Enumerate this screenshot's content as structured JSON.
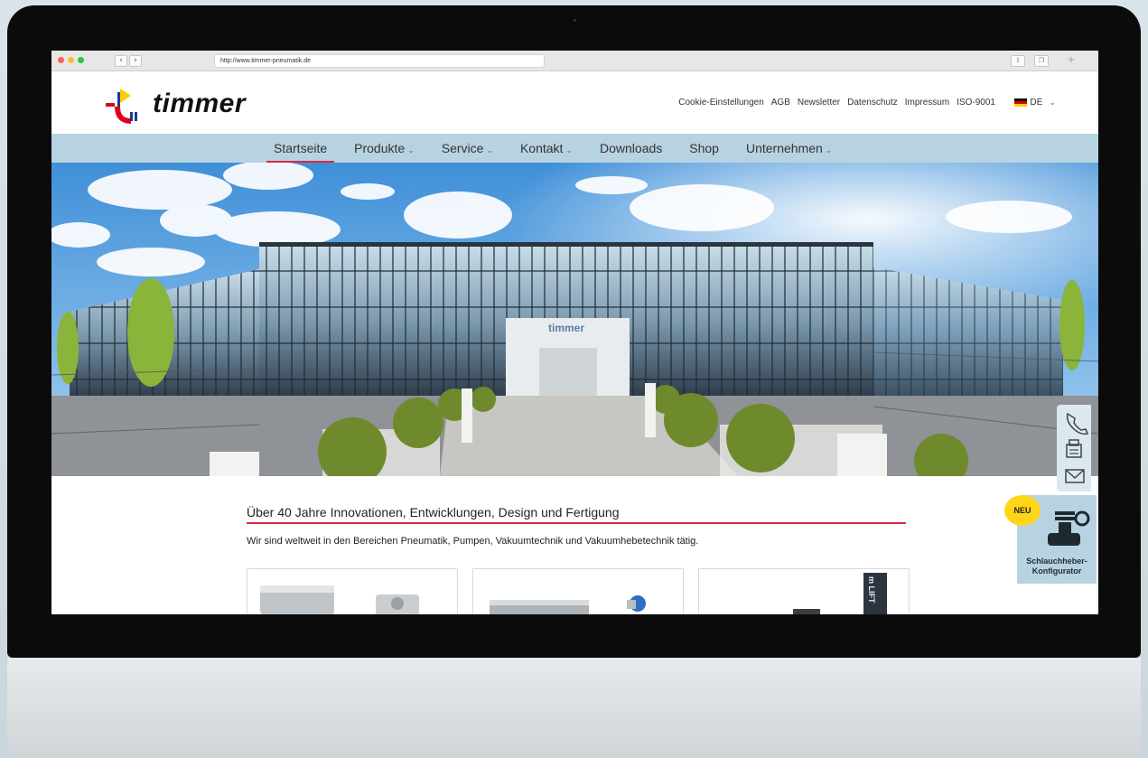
{
  "browser": {
    "url": "http://www.timmer-pneumatik.de",
    "back_label": "‹",
    "forward_label": "›",
    "share_label": "⇧",
    "tabs_label": "❐",
    "newtab_label": "+"
  },
  "header": {
    "brand": "timmer",
    "top_links": [
      "Cookie-Einstellungen",
      "AGB",
      "Newsletter",
      "Datenschutz",
      "Impressum",
      "ISO-9001"
    ],
    "language": "DE"
  },
  "main_nav": {
    "items": [
      {
        "label": "Startseite",
        "active": true,
        "dropdown": false
      },
      {
        "label": "Produkte",
        "active": false,
        "dropdown": true
      },
      {
        "label": "Service",
        "active": false,
        "dropdown": true
      },
      {
        "label": "Kontakt",
        "active": false,
        "dropdown": true
      },
      {
        "label": "Downloads",
        "active": false,
        "dropdown": false
      },
      {
        "label": "Shop",
        "active": false,
        "dropdown": false
      },
      {
        "label": "Unternehmen",
        "active": false,
        "dropdown": true
      }
    ]
  },
  "hero": {
    "building_sign": "timmer"
  },
  "content": {
    "heading": "Über 40 Jahre Innovationen, Entwicklungen, Design und Fertigung",
    "subheading": "Wir sind weltweit in den Bereichen Pneumatik, Pumpen, Vakuumtechnik und Vakuumhebetechnik tätig.",
    "card3_label": "m LIFT"
  },
  "side_widget": {
    "icons": [
      "phone-icon",
      "fax-icon",
      "mail-icon"
    ]
  },
  "configurator": {
    "badge": "NEU",
    "label_line1": "Schlauchheber-",
    "label_line2": "Konfigurator"
  },
  "colors": {
    "accent_red": "#d72a42",
    "nav_blue": "#b7d3e2",
    "badge_yellow": "#ffd51a"
  }
}
